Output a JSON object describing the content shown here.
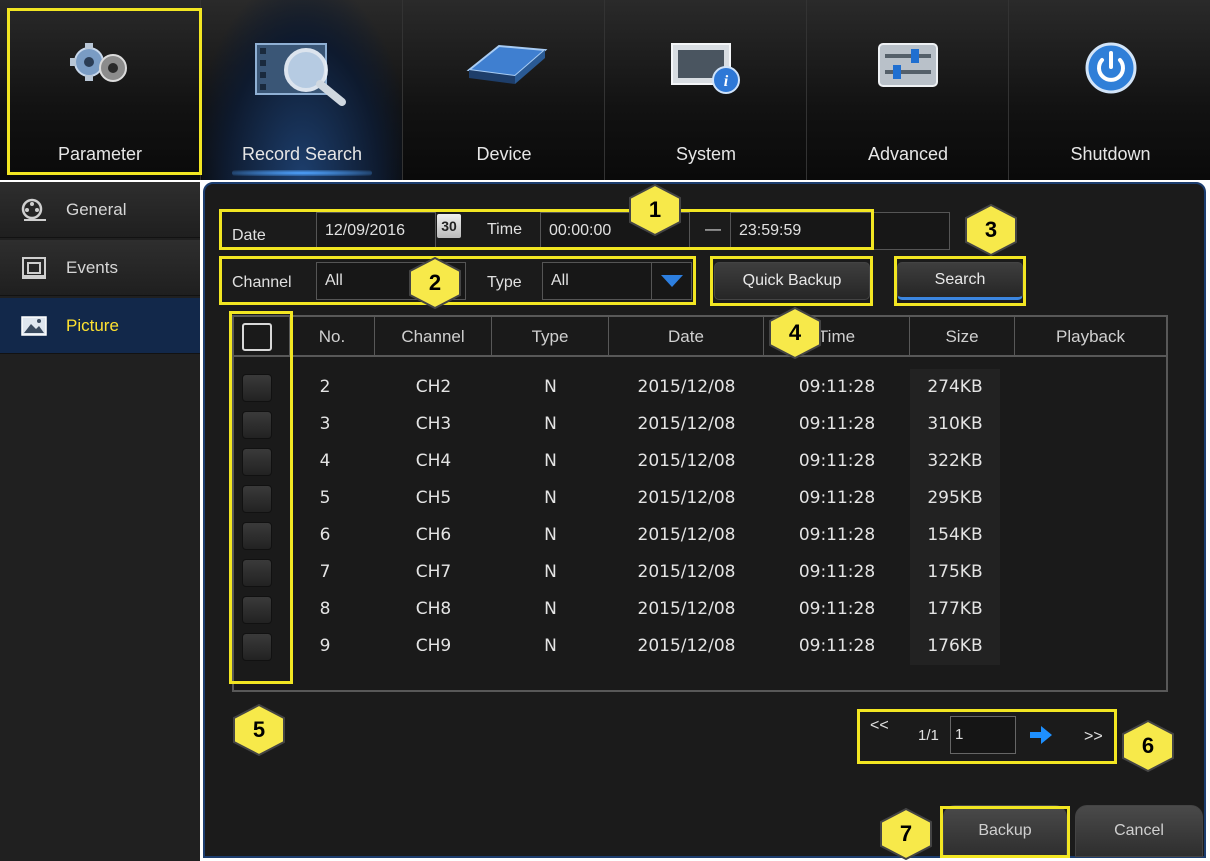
{
  "top_menu": [
    {
      "label": "Parameter",
      "icon": "gears-icon"
    },
    {
      "label": "Record Search",
      "icon": "record-search-icon"
    },
    {
      "label": "Device",
      "icon": "hard-drive-icon"
    },
    {
      "label": "System",
      "icon": "system-info-icon"
    },
    {
      "label": "Advanced",
      "icon": "sliders-icon"
    },
    {
      "label": "Shutdown",
      "icon": "power-icon"
    }
  ],
  "active_top": "Record Search",
  "sidebar": {
    "items": [
      {
        "label": "General",
        "icon": "film-reel-icon"
      },
      {
        "label": "Events",
        "icon": "event-icon"
      },
      {
        "label": "Picture",
        "icon": "picture-icon"
      }
    ],
    "active": "Picture"
  },
  "filters": {
    "date_label": "Date",
    "date_value": "12/09/2016",
    "calendar_day": "30",
    "time_label": "Time",
    "time_start": "00:00:00",
    "time_separator": "—",
    "time_end": "23:59:59",
    "channel_label": "Channel",
    "channel_value": "All",
    "type_label": "Type",
    "type_value": "All"
  },
  "buttons": {
    "quick_backup": "Quick Backup",
    "search": "Search",
    "backup": "Backup",
    "cancel": "Cancel"
  },
  "table": {
    "columns": [
      "No.",
      "Channel",
      "Type",
      "Date",
      "Time",
      "Size",
      "Playback"
    ],
    "rows": [
      {
        "no": "2",
        "channel": "CH2",
        "type": "N",
        "date": "2015/12/08",
        "time": "09:11:28",
        "size": "274KB"
      },
      {
        "no": "3",
        "channel": "CH3",
        "type": "N",
        "date": "2015/12/08",
        "time": "09:11:28",
        "size": "310KB"
      },
      {
        "no": "4",
        "channel": "CH4",
        "type": "N",
        "date": "2015/12/08",
        "time": "09:11:28",
        "size": "322KB"
      },
      {
        "no": "5",
        "channel": "CH5",
        "type": "N",
        "date": "2015/12/08",
        "time": "09:11:28",
        "size": "295KB"
      },
      {
        "no": "6",
        "channel": "CH6",
        "type": "N",
        "date": "2015/12/08",
        "time": "09:11:28",
        "size": "154KB"
      },
      {
        "no": "7",
        "channel": "CH7",
        "type": "N",
        "date": "2015/12/08",
        "time": "09:11:28",
        "size": "175KB"
      },
      {
        "no": "8",
        "channel": "CH8",
        "type": "N",
        "date": "2015/12/08",
        "time": "09:11:28",
        "size": "177KB"
      },
      {
        "no": "9",
        "channel": "CH9",
        "type": "N",
        "date": "2015/12/08",
        "time": "09:11:28",
        "size": "176KB"
      }
    ]
  },
  "pagination": {
    "first": "<<",
    "page_info": "1/1",
    "page_input": "1",
    "last": ">>"
  },
  "callouts": [
    "1",
    "2",
    "3",
    "4",
    "5",
    "6",
    "7"
  ],
  "colors": {
    "highlight": "#f2e622",
    "callout_fill": "#f7e94a",
    "active_side_text": "#ffe230",
    "accent_blue": "#1c3d6e",
    "next_arrow": "#1e90ff"
  }
}
